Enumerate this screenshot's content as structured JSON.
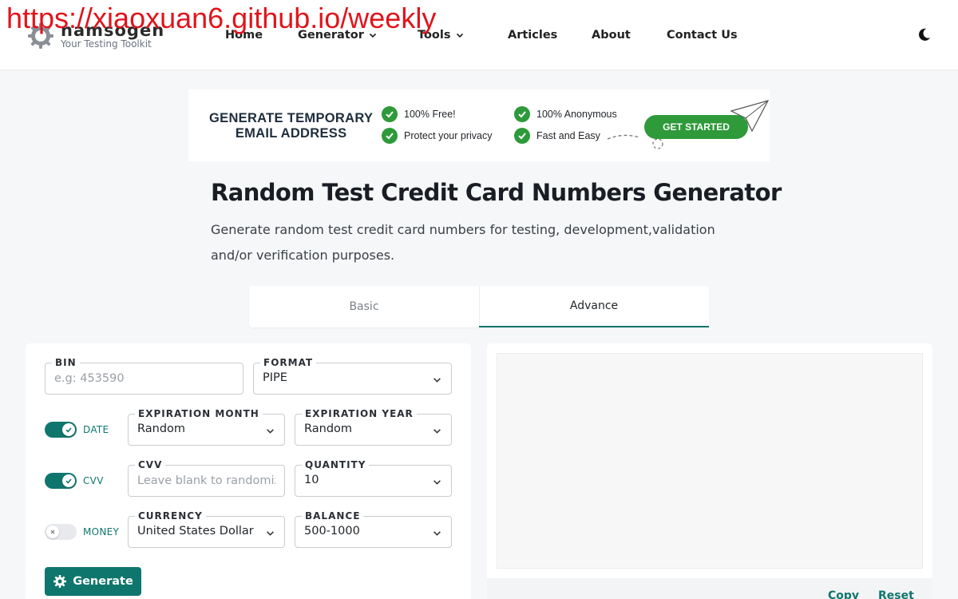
{
  "watermark": "https://xiaoxuan6.github.io/weekly",
  "brand": {
    "name": "namsogen",
    "tagline": "Your Testing Toolkit"
  },
  "nav": {
    "home": "Home",
    "generator": "Generator",
    "tools": "Tools",
    "articles": "Articles",
    "about": "About",
    "contact": "Contact Us"
  },
  "banner": {
    "headline_1": "GENERATE TEMPORARY",
    "headline_2": "EMAIL ADDRESS",
    "features": [
      "100% Free!",
      "Protect your privacy",
      "100% Anonymous",
      "Fast and Easy"
    ],
    "cta": "GET STARTED",
    "accent_color": "#2e9a3a"
  },
  "page": {
    "title": "Random Test Credit Card Numbers Generator",
    "description": "Generate random test credit card numbers for testing, development,validation and/or verification purposes."
  },
  "tabs": [
    "Basic",
    "Advance"
  ],
  "active_tab": "Advance",
  "form": {
    "bin": {
      "label": "BIN",
      "placeholder": "e.g: 453590",
      "value": ""
    },
    "format": {
      "label": "FORMAT",
      "value": "PIPE"
    },
    "date_toggle": {
      "label": "DATE",
      "on": true
    },
    "expiration_month": {
      "label": "EXPIRATION MONTH",
      "value": "Random"
    },
    "expiration_year": {
      "label": "EXPIRATION YEAR",
      "value": "Random"
    },
    "cvv_toggle": {
      "label": "CVV",
      "on": true
    },
    "cvv": {
      "label": "CVV",
      "placeholder": "Leave blank to randomize",
      "value": ""
    },
    "quantity": {
      "label": "QUANTITY",
      "value": "10"
    },
    "money_toggle": {
      "label": "MONEY",
      "on": false
    },
    "currency": {
      "label": "CURRENCY",
      "value": "United States Dollar"
    },
    "balance": {
      "label": "BALANCE",
      "value": "500-1000"
    },
    "generate": "Generate"
  },
  "output": {
    "copy": "Copy",
    "reset": "Reset"
  },
  "colors": {
    "primary": "#0f766e",
    "watermark": "#e1141b"
  }
}
